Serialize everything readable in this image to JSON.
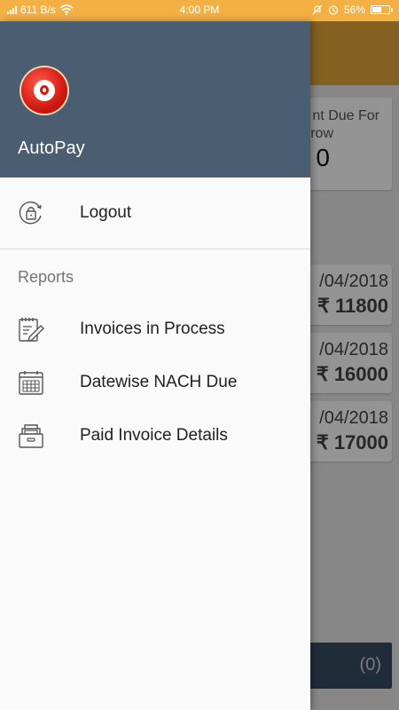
{
  "status_bar": {
    "speed": "611 B/s",
    "time": "4:00 PM",
    "battery": "56%",
    "battery_level": 0.56
  },
  "background": {
    "due_card": {
      "line1": "nt Due For",
      "line2": "row",
      "value": "0"
    },
    "rows": [
      {
        "date": "/04/2018",
        "amount": "₹ 11800"
      },
      {
        "date": "/04/2018",
        "amount": "₹ 16000"
      },
      {
        "date": "/04/2018",
        "amount": "₹ 17000"
      }
    ],
    "bottom_count": "(0)",
    "colors": {
      "header": "#e4a83a",
      "bottom_bar": "#3a4d63"
    }
  },
  "drawer": {
    "app_name": "AutoPay",
    "logout": {
      "label": "Logout",
      "icon": "logout-lock-icon"
    },
    "reports_heading": "Reports",
    "items": [
      {
        "label": "Invoices in Process",
        "icon": "edit-document-icon"
      },
      {
        "label": "Datewise NACH Due",
        "icon": "calendar-icon"
      },
      {
        "label": "Paid Invoice Details",
        "icon": "archive-box-icon"
      }
    ],
    "colors": {
      "header": "#4b5d70",
      "background": "#fafafa"
    }
  }
}
